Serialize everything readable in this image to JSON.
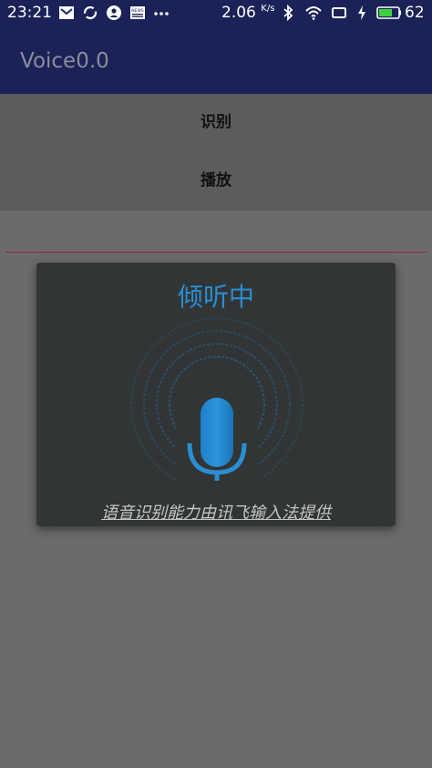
{
  "status_bar": {
    "time": "23:21",
    "network_speed": "2.06",
    "network_speed_unit": "K/s",
    "battery_percent": "62",
    "news_label": "NEWS",
    "icons": [
      "mail-icon",
      "sync-icon",
      "account-icon",
      "news-icon",
      "more-dots-icon",
      "bluetooth-icon",
      "wifi-icon",
      "cast-icon",
      "charging-icon",
      "battery-icon"
    ]
  },
  "app_bar": {
    "title": "Voice0.0"
  },
  "buttons": {
    "recognize_label": "识别",
    "play_label": "播放"
  },
  "dialog": {
    "heading": "倾听中",
    "credit": "语音识别能力由讯飞输入法提供",
    "mic_icon": "microphone-icon"
  },
  "colors": {
    "status_bar_bg": "#1b2257",
    "accent": "#2a8ed3",
    "dialog_bg": "#323536",
    "divider": "#8c2838"
  }
}
